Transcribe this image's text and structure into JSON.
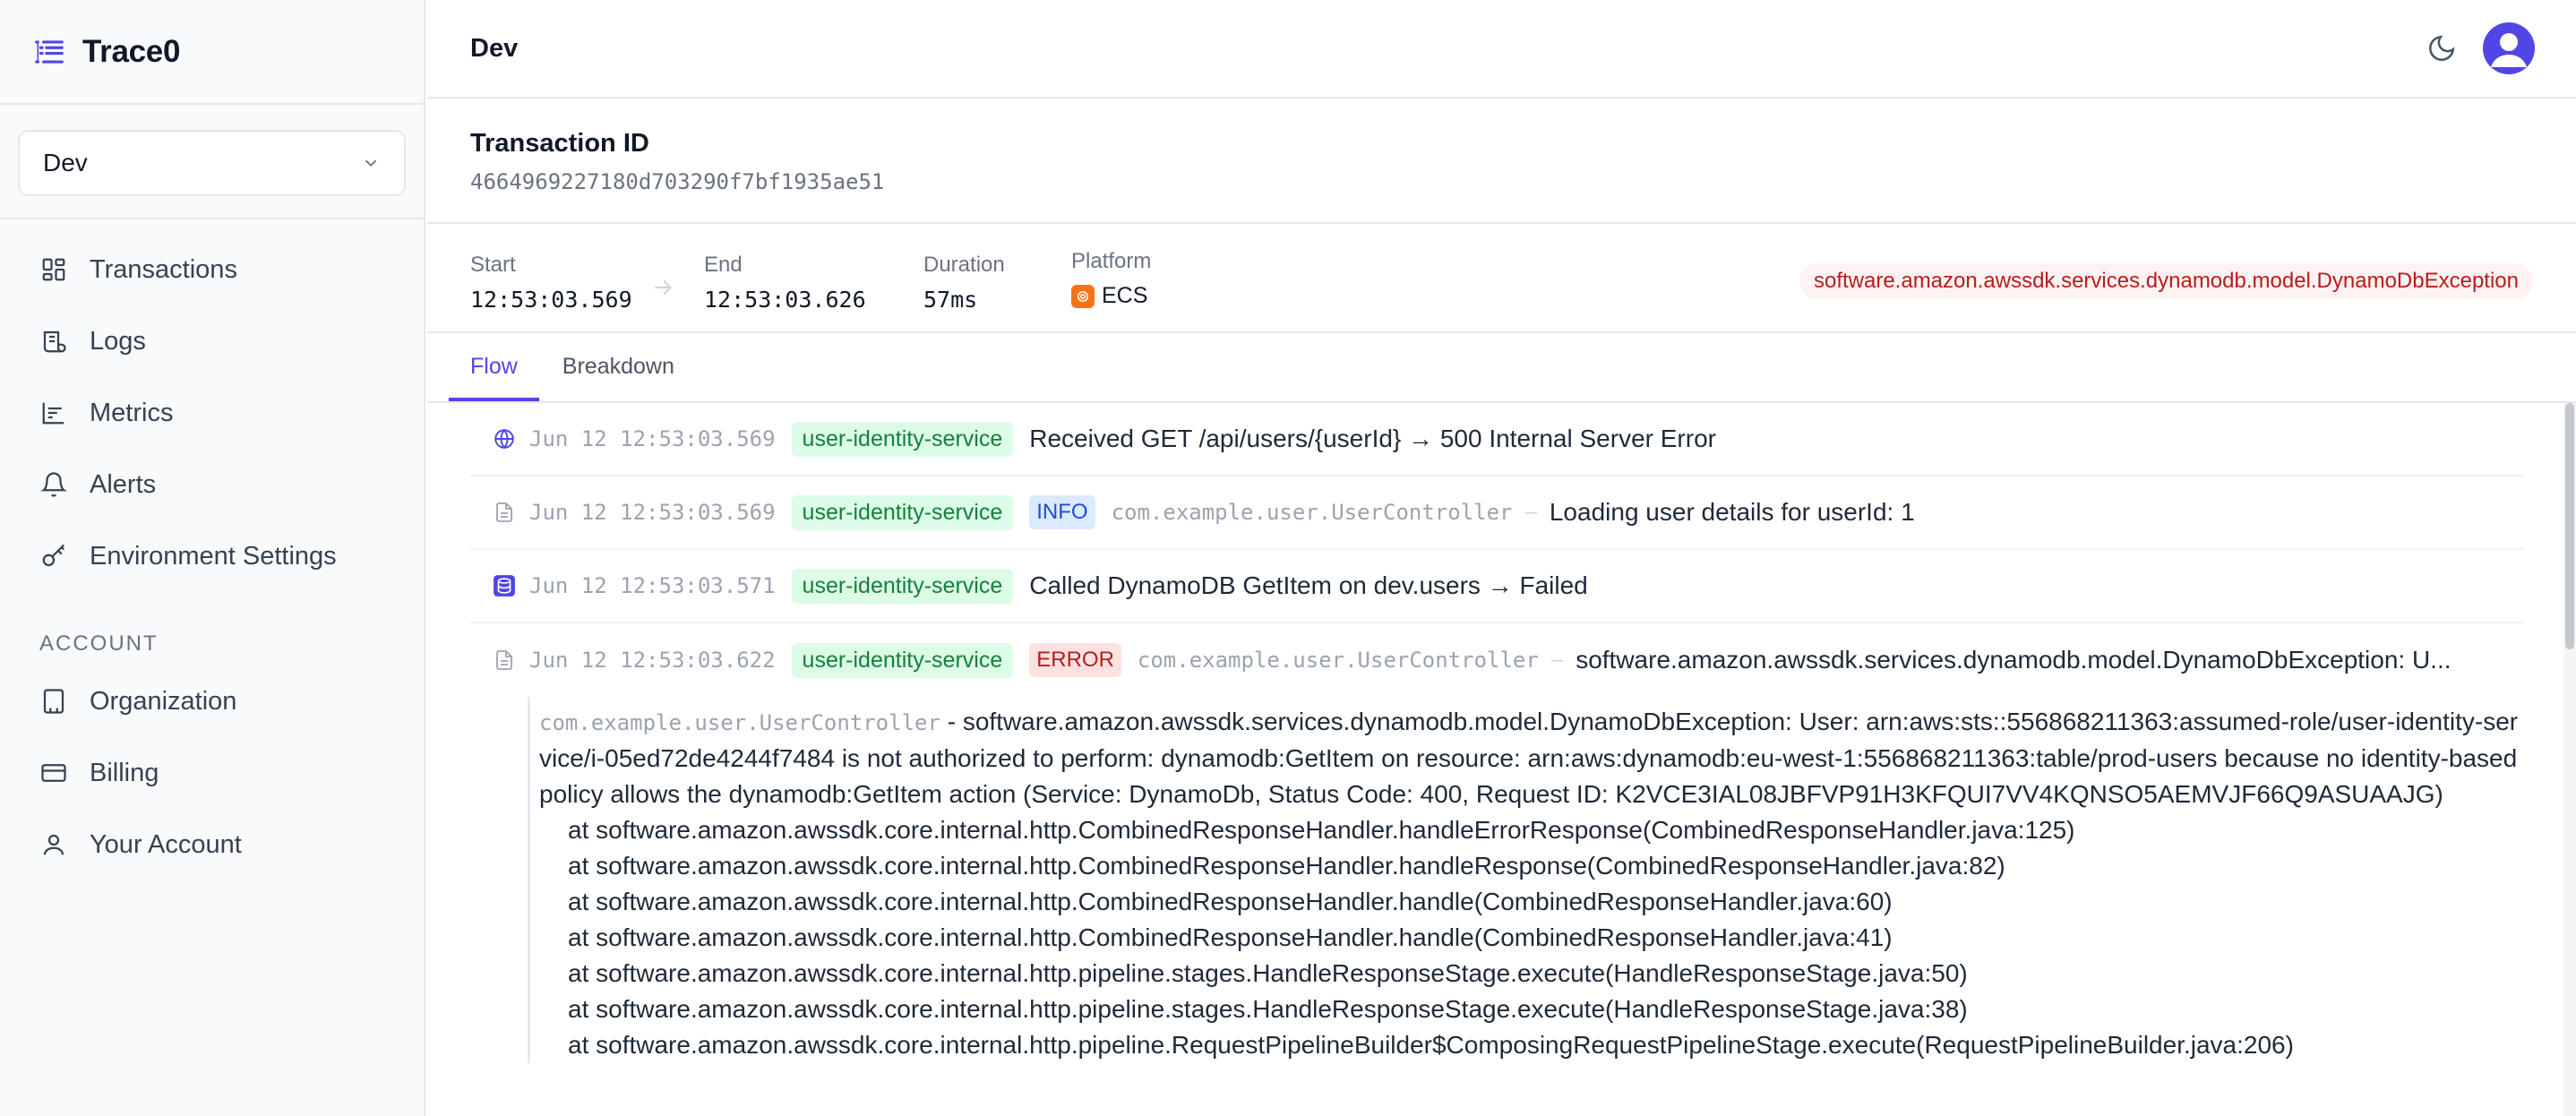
{
  "app": {
    "name": "Trace0"
  },
  "sidebar": {
    "environment": "Dev",
    "items": [
      {
        "label": "Transactions",
        "icon": "grid-icon"
      },
      {
        "label": "Logs",
        "icon": "scroll-icon"
      },
      {
        "label": "Metrics",
        "icon": "bar-chart-icon"
      },
      {
        "label": "Alerts",
        "icon": "bell-icon"
      },
      {
        "label": "Environment Settings",
        "icon": "key-icon"
      }
    ],
    "account_heading": "ACCOUNT",
    "account_items": [
      {
        "label": "Organization",
        "icon": "building-icon"
      },
      {
        "label": "Billing",
        "icon": "credit-card-icon"
      },
      {
        "label": "Your Account",
        "icon": "user-icon"
      }
    ]
  },
  "header": {
    "title": "Dev"
  },
  "transaction": {
    "heading": "Transaction ID",
    "id": "4664969227180d703290f7bf1935ae51",
    "start_label": "Start",
    "start": "12:53:03.569",
    "end_label": "End",
    "end": "12:53:03.626",
    "duration_label": "Duration",
    "duration": "57ms",
    "platform_label": "Platform",
    "platform": "ECS",
    "exception": "software.amazon.awssdk.services.dynamodb.model.DynamoDbException"
  },
  "tabs": [
    "Flow",
    "Breakdown"
  ],
  "flow": {
    "rows": [
      {
        "icon": "globe-icon",
        "time": "Jun 12 12:53:03.569",
        "service": "user-identity-service",
        "message": "Received GET /api/users/{userId} → 500 Internal Server Error"
      },
      {
        "icon": "document-icon",
        "time": "Jun 12 12:53:03.569",
        "service": "user-identity-service",
        "level": "INFO",
        "logger": "com.example.user.UserController",
        "message": "Loading user details for userId: 1"
      },
      {
        "icon": "dynamodb-icon",
        "time": "Jun 12 12:53:03.571",
        "service": "user-identity-service",
        "message": "Called DynamoDB GetItem on dev.users → Failed"
      },
      {
        "icon": "document-icon",
        "time": "Jun 12 12:53:03.622",
        "service": "user-identity-service",
        "level": "ERROR",
        "logger": "com.example.user.UserController",
        "message": "software.amazon.awssdk.services.dynamodb.model.DynamoDbException: U..."
      }
    ],
    "detail": {
      "logger": "com.example.user.UserController",
      "separator": " - ",
      "message": "software.amazon.awssdk.services.dynamodb.model.DynamoDbException: User: arn:aws:sts::556868211363:assumed-role/user-identity-service/i-05ed72de4244f7484 is not authorized to perform: dynamodb:GetItem on resource: arn:aws:dynamodb:eu-west-1:556868211363:table/prod-users because no identity-based policy allows the dynamodb:GetItem action (Service: DynamoDb, Status Code: 400, Request ID: K2VCE3IAL08JBFVP91H3KFQUI7VV4KQNSO5AEMVJF66Q9ASUAAJG)",
      "stack": [
        "at software.amazon.awssdk.core.internal.http.CombinedResponseHandler.handleErrorResponse(CombinedResponseHandler.java:125)",
        "at software.amazon.awssdk.core.internal.http.CombinedResponseHandler.handleResponse(CombinedResponseHandler.java:82)",
        "at software.amazon.awssdk.core.internal.http.CombinedResponseHandler.handle(CombinedResponseHandler.java:60)",
        "at software.amazon.awssdk.core.internal.http.CombinedResponseHandler.handle(CombinedResponseHandler.java:41)",
        "at software.amazon.awssdk.core.internal.http.pipeline.stages.HandleResponseStage.execute(HandleResponseStage.java:50)",
        "at software.amazon.awssdk.core.internal.http.pipeline.stages.HandleResponseStage.execute(HandleResponseStage.java:38)",
        "at software.amazon.awssdk.core.internal.http.pipeline.RequestPipelineBuilder$ComposingRequestPipelineStage.execute(RequestPipelineBuilder.java:206)"
      ]
    }
  },
  "colors": {
    "accent": "#4f46e5",
    "service_badge": "#dcfce7",
    "error": "#b91c1c"
  }
}
